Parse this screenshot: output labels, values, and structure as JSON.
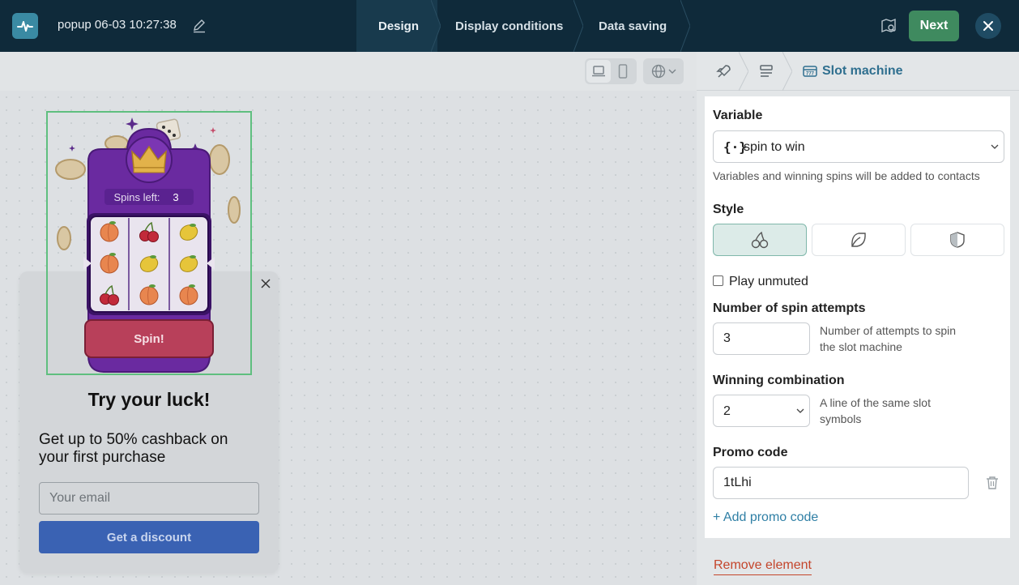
{
  "header": {
    "popup_title": "popup 06-03 10:27:38",
    "steps": [
      "Design",
      "Display conditions",
      "Data saving"
    ],
    "active_step": "Design",
    "next_label": "Next"
  },
  "popup": {
    "spins_label": "Spins left:",
    "spins_count": "3",
    "spin_button": "Spin!",
    "heading": "Try your luck!",
    "subheading": "Get up to 50% cashback on your first purchase",
    "email_placeholder": "Your email",
    "discount_button": "Get a discount",
    "reels": [
      [
        "peach",
        "cherry",
        "lemon"
      ],
      [
        "peach",
        "lemon",
        "lemon"
      ],
      [
        "cherry",
        "peach",
        "peach"
      ]
    ]
  },
  "panel": {
    "breadcrumb_title": "Slot machine",
    "variable_label": "Variable",
    "variable_value": "spin to win",
    "variable_hint": "Variables and winning spins will be added to contacts",
    "style_label": "Style",
    "style_options": [
      "cherry-icon",
      "leaf-icon",
      "shield-icon"
    ],
    "play_unmuted_label": "Play unmuted",
    "spin_attempts_label": "Number of spin attempts",
    "spin_attempts_value": "3",
    "spin_attempts_hint": "Number of attempts to spin the slot machine",
    "winning_label": "Winning combination",
    "winning_value": "2",
    "winning_hint": "A line of the same slot symbols",
    "promo_label": "Promo code",
    "promo_value": "1tLhi",
    "add_promo": "+ Add promo code",
    "remove_element": "Remove element"
  },
  "colors": {
    "topbar": "#0f2a3a",
    "next_button": "#3f8a5f",
    "accent_blue": "#2f7fa5",
    "remove_red": "#c4452b",
    "slot_purple": "#6a2aa0",
    "spin_button": "#b8405a"
  }
}
